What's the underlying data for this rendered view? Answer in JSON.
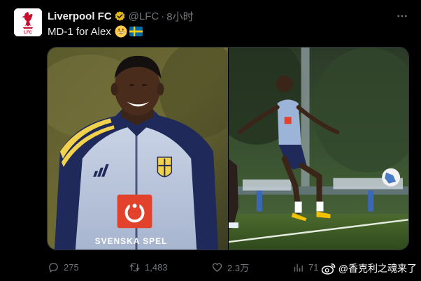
{
  "author": {
    "name": "Liverpool FC",
    "handle": "@LFC",
    "separator": "·",
    "time": "8小时",
    "avatar_label": "LFC",
    "avatar_color": "#c8102e",
    "verified_badge_color": "#e2b719"
  },
  "tweet": {
    "text": "MD-1 for Alex",
    "emojis": [
      "grinning-face-icon",
      "sweden-flag-icon"
    ]
  },
  "media": {
    "left_photo": {
      "shirt_sponsor": "SVENSKA SPEL"
    },
    "right_photo": {}
  },
  "actions": {
    "replies": "275",
    "retweets": "1,483",
    "likes": "2.3万",
    "views": "71"
  },
  "watermark": {
    "text": "@香克利之魂来了"
  },
  "colors": {
    "background": "#000000",
    "primary_text": "#e7e9ea",
    "secondary_text": "#71767b",
    "border": "#2f3336"
  }
}
